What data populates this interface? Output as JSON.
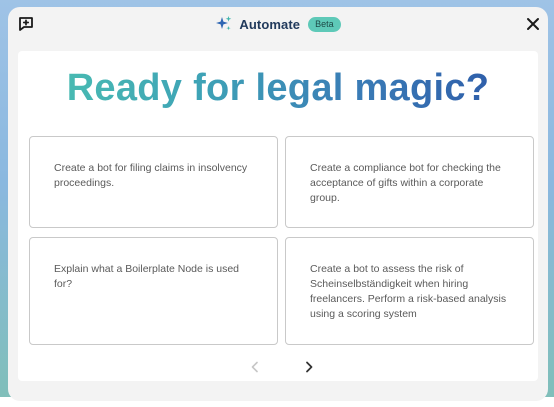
{
  "header": {
    "title": "Automate",
    "badge": "Beta",
    "new_chat_icon": "new-chat-icon",
    "close_icon": "close-icon"
  },
  "main": {
    "headline": "Ready for legal magic?",
    "suggestions": [
      {
        "text": "Create a bot for filing claims in insolvency proceedings."
      },
      {
        "text": "Create a compliance bot for checking the acceptance of gifts within a corporate group."
      },
      {
        "text": "Explain what a Boilerplate Node is used for?"
      },
      {
        "text": "Create a bot to assess the risk of Scheinselbständigkeit when hiring freelancers. Perform a risk-based analysis using a scoring system"
      }
    ],
    "pager": {
      "prev_icon": "chevron-left-icon",
      "next_icon": "chevron-right-icon"
    }
  },
  "colors": {
    "accent_teal": "#4cc2b1",
    "accent_blue": "#2b55a6",
    "badge": "#5ec9b8",
    "title": "#213a5c"
  }
}
